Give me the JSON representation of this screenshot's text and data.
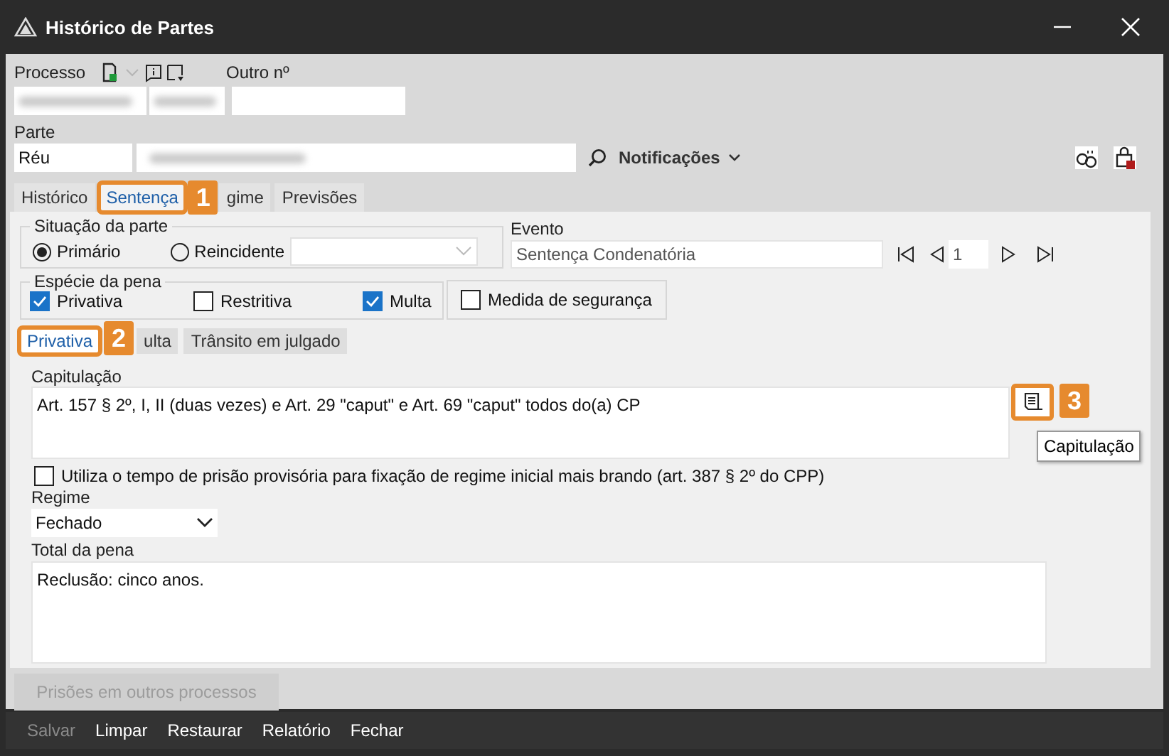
{
  "window": {
    "title": "Histórico de Partes"
  },
  "processo": {
    "label": "Processo",
    "other_label": "Outro nº"
  },
  "parte": {
    "label": "Parte",
    "type_value": "Réu",
    "notifications": "Notificações"
  },
  "tabs": [
    {
      "label": "Histórico",
      "selected": false
    },
    {
      "label": "Sentença",
      "selected": true,
      "callout": "1"
    },
    {
      "label": "gime",
      "selected": false
    },
    {
      "label": "Previsões",
      "selected": false
    }
  ],
  "situacao": {
    "label": "Situação da parte",
    "options": [
      {
        "label": "Primário",
        "selected": true
      },
      {
        "label": "Reincidente",
        "selected": false
      }
    ]
  },
  "evento": {
    "label": "Evento",
    "value": "Sentença Condenatória",
    "page": "1"
  },
  "especie": {
    "label": "Espécie da pena",
    "options": [
      {
        "label": "Privativa",
        "checked": true
      },
      {
        "label": "Restritiva",
        "checked": false
      },
      {
        "label": "Multa",
        "checked": true
      },
      {
        "label": "Medida de segurança",
        "checked": false
      }
    ]
  },
  "subtabs": [
    {
      "label": "Privativa",
      "selected": true,
      "callout": "2"
    },
    {
      "label": "ulta",
      "selected": false
    },
    {
      "label": "Trânsito em julgado",
      "selected": false
    }
  ],
  "capitulacao": {
    "label": "Capitulação",
    "value": "Art. 157 § 2º, I, II (duas vezes) e Art. 29 \"caput\" e Art. 69 \"caput\" todos do(a) CP",
    "callout": "3",
    "tooltip": "Capitulação"
  },
  "detracao": {
    "label": "Utiliza o tempo de prisão provisória para fixação de regime inicial mais brando (art. 387 § 2º do CPP)",
    "checked": false
  },
  "regime": {
    "label": "Regime",
    "value": "Fechado"
  },
  "total": {
    "label": "Total da pena",
    "value": "Reclusão: cinco anos."
  },
  "other_button": {
    "label": "Prisões em outros processos",
    "disabled": true
  },
  "footer": [
    {
      "label": "Salvar",
      "disabled": true
    },
    {
      "label": "Limpar",
      "disabled": false
    },
    {
      "label": "Restaurar",
      "disabled": false
    },
    {
      "label": "Relatório",
      "disabled": false
    },
    {
      "label": "Fechar",
      "disabled": false
    }
  ]
}
